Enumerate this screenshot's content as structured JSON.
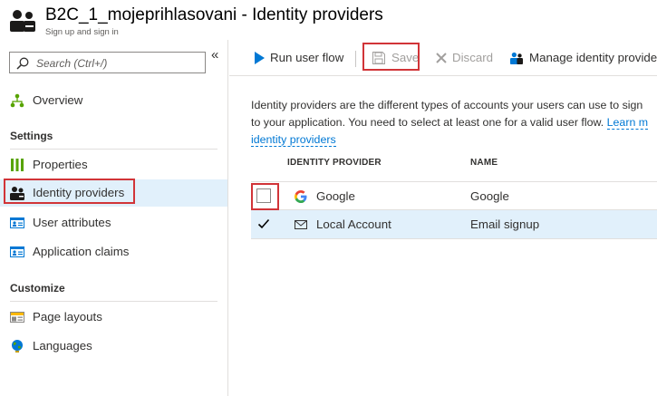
{
  "header": {
    "title": "B2C_1_mojeprihlasovani - Identity providers",
    "subtitle": "Sign up and sign in"
  },
  "sidebar": {
    "search_placeholder": "Search (Ctrl+/)",
    "collapse_glyph": "«",
    "overview": "Overview",
    "settings_label": "Settings",
    "settings_items": [
      {
        "label": "Properties",
        "icon": "properties-icon"
      },
      {
        "label": "Identity providers",
        "icon": "identity-providers-icon",
        "selected": true
      },
      {
        "label": "User attributes",
        "icon": "user-attributes-icon"
      },
      {
        "label": "Application claims",
        "icon": "application-claims-icon"
      }
    ],
    "customize_label": "Customize",
    "customize_items": [
      {
        "label": "Page layouts",
        "icon": "page-layouts-icon"
      },
      {
        "label": "Languages",
        "icon": "languages-icon"
      }
    ]
  },
  "toolbar": {
    "run_label": "Run user flow",
    "save_label": "Save",
    "discard_label": "Discard",
    "manage_label": "Manage identity provide"
  },
  "main": {
    "desc_line1": "Identity providers are the different types of accounts your users can use to sign",
    "desc_line2": "to your application. You need to select at least one for a valid user flow.",
    "desc_link1": "Learn m",
    "desc_link2": "identity providers",
    "col_provider": "IDENTITY PROVIDER",
    "col_name": "NAME",
    "rows": [
      {
        "provider": "Google",
        "name": "Google",
        "checked": false,
        "icon": "google-icon"
      },
      {
        "provider": "Local Account",
        "name": "Email signup",
        "checked": true,
        "icon": "mail-icon"
      }
    ]
  },
  "colors": {
    "accent": "#0078d4",
    "highlight": "#d13438",
    "selected_bg": "#e1f0fb"
  }
}
